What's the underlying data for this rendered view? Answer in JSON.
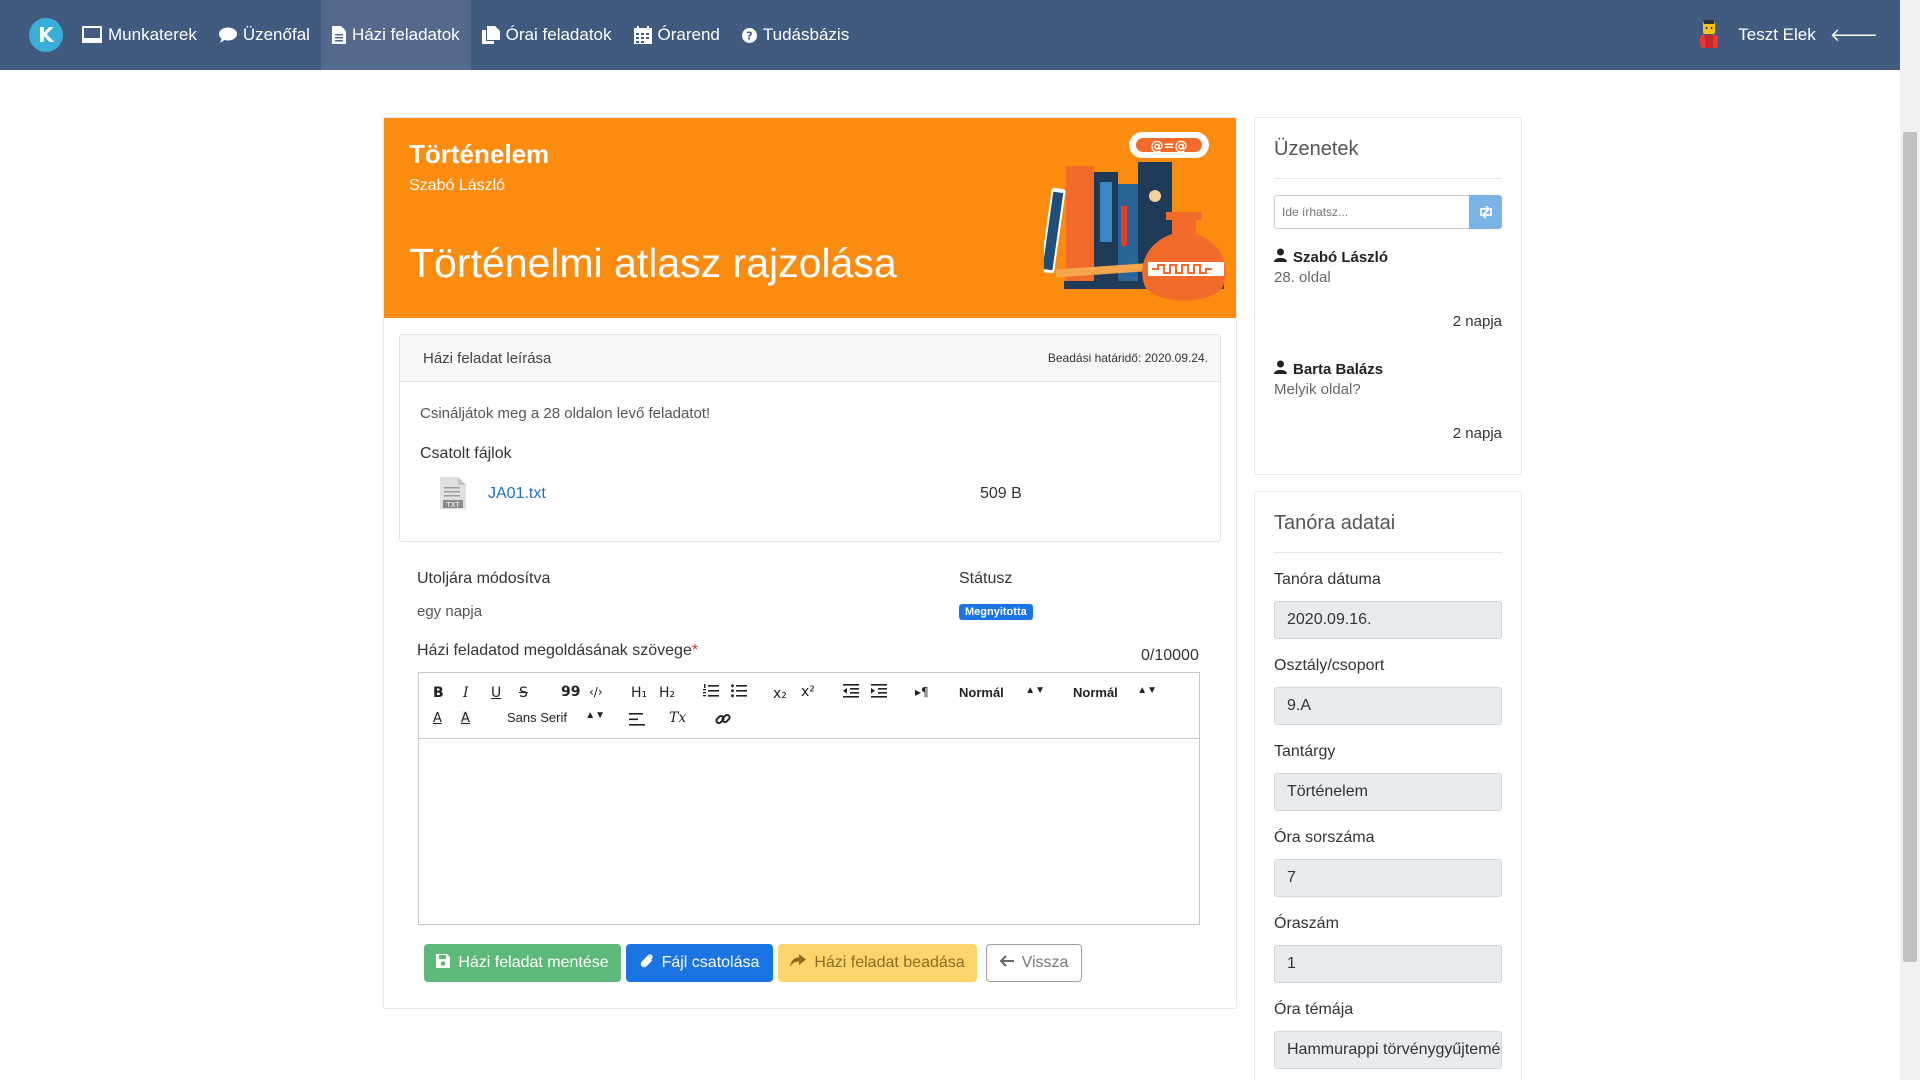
{
  "nav": {
    "brand": "K",
    "items": [
      {
        "label": "Munkaterek",
        "icon": "monitor-icon"
      },
      {
        "label": "Üzenőfal",
        "icon": "chat-bubble-icon"
      },
      {
        "label": "Házi feladatok",
        "icon": "document-icon"
      },
      {
        "label": "Órai feladatok",
        "icon": "copy-icon"
      },
      {
        "label": "Órarend",
        "icon": "calendar-icon"
      },
      {
        "label": "Tudásbázis",
        "icon": "question-circle-icon"
      }
    ],
    "active_index": 2,
    "user": "Teszt Elek"
  },
  "hero": {
    "subject": "Történelem",
    "teacher": "Szabó László",
    "title": "Történelmi atlasz rajzolása",
    "bg_color": "#fb8c10"
  },
  "description": {
    "header": "Házi feladat leírása",
    "deadline": "Beadási határidő: 2020.09.24.",
    "text": "Csináljátok meg a 28 oldalon levő feladatot!",
    "attachments_title": "Csatolt fájlok",
    "file_name": "JA01.txt",
    "file_size": "509 B",
    "file_icon_label": "TXT"
  },
  "status": {
    "modified_label": "Utoljára módosítva",
    "modified_value": "egy napja",
    "status_label": "Státusz",
    "status_value": "Megnyitotta"
  },
  "solution": {
    "label": "Házi feladatod megoldásának szövege",
    "required_mark": "*",
    "counter": "0/10000",
    "toolbar": {
      "bold": "B",
      "italic": "I",
      "underline": "U",
      "strike": "S",
      "quote": "99",
      "code": "‹/›",
      "h1": "H₁",
      "h2": "H₂",
      "sub": "x₂",
      "sup": "x²",
      "rtl": "▸¶",
      "size_select": "Normál",
      "header_select": "Normál",
      "font_select": "Sans Serif",
      "text_color": "A",
      "bg_color": "A",
      "clear": "Tx"
    }
  },
  "buttons": {
    "save": "Házi feladat mentése",
    "attach": "Fájl csatolása",
    "submit": "Házi feladat beadása",
    "back": "Vissza"
  },
  "messages": {
    "title": "Üzenetek",
    "placeholder": "Ide írhatsz...",
    "items": [
      {
        "author": "Szabó László",
        "text": "28. oldal",
        "time": "2 napja"
      },
      {
        "author": "Barta Balázs",
        "text": "Melyik oldal?",
        "time": "2 napja"
      }
    ]
  },
  "lesson": {
    "title": "Tanóra adatai",
    "fields": [
      {
        "label": "Tanóra dátuma",
        "value": "2020.09.16."
      },
      {
        "label": "Osztály/csoport",
        "value": "9.A"
      },
      {
        "label": "Tantárgy",
        "value": "Történelem"
      },
      {
        "label": "Óra sorszáma",
        "value": "7"
      },
      {
        "label": "Óraszám",
        "value": "1"
      },
      {
        "label": "Óra témája",
        "value": "Hammurappi törvénygyűjteménye"
      }
    ]
  },
  "colors": {
    "navbar": "#415a80",
    "nav_active": "#55698c",
    "success": "#5cb97a",
    "primary": "#1b74e4",
    "warning": "#fcd56b"
  }
}
